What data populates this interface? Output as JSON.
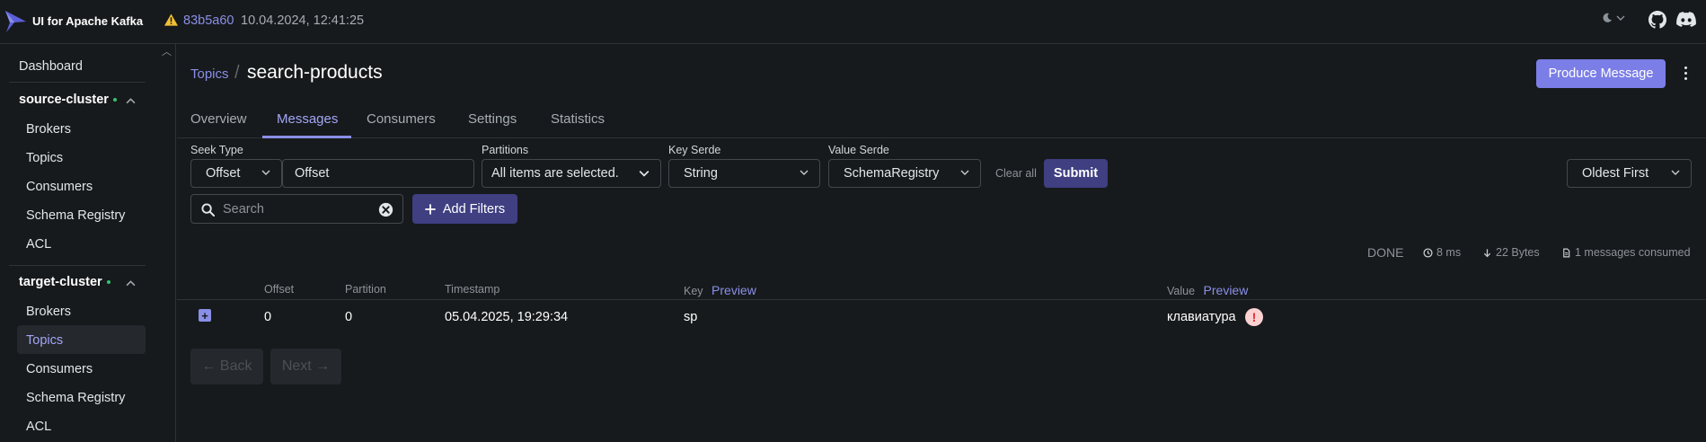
{
  "app": {
    "brand": "UI for Apache Kafka",
    "version": "83b5a60",
    "build_date": "10.04.2024, 12:41:25",
    "accent_color": "#8a8fe8",
    "icons": [
      "kafka-logo-icon",
      "warning-icon",
      "moon-icon",
      "chevron-down-icon",
      "github-icon",
      "discord-icon"
    ]
  },
  "sidebar": {
    "dashboard": "Dashboard",
    "clusters": [
      {
        "name": "source-cluster",
        "items": [
          "Brokers",
          "Topics",
          "Consumers",
          "Schema Registry",
          "ACL"
        ]
      },
      {
        "name": "target-cluster",
        "items": [
          "Brokers",
          "Topics",
          "Consumers",
          "Schema Registry",
          "ACL"
        ],
        "active_item": "Topics"
      }
    ]
  },
  "breadcrumb": {
    "parent": "Topics",
    "separator": "/",
    "current": "search-products"
  },
  "actions": {
    "produce_message": "Produce Message"
  },
  "tabs": [
    {
      "label": "Overview"
    },
    {
      "label": "Messages",
      "active": true
    },
    {
      "label": "Consumers"
    },
    {
      "label": "Settings"
    },
    {
      "label": "Statistics"
    }
  ],
  "filters": {
    "seek_type_label": "Seek Type",
    "seek_type_value": "Offset",
    "offset_placeholder": "Offset",
    "partitions_label": "Partitions",
    "partitions_value": "All items are selected.",
    "key_serde_label": "Key Serde",
    "key_serde_value": "String",
    "value_serde_label": "Value Serde",
    "value_serde_value": "SchemaRegistry",
    "clear_all": "Clear all",
    "submit": "Submit",
    "sort_value": "Oldest First",
    "search_placeholder": "Search",
    "add_filters": "Add Filters"
  },
  "status": {
    "state": "DONE",
    "elapsed": "8 ms",
    "bytes": "22 Bytes",
    "consumed": "1 messages consumed"
  },
  "table": {
    "columns": {
      "offset": "Offset",
      "partition": "Partition",
      "timestamp": "Timestamp",
      "key": "Key",
      "key_preview": "Preview",
      "value": "Value",
      "value_preview": "Preview"
    },
    "rows": [
      {
        "offset": "0",
        "partition": "0",
        "timestamp": "05.04.2025, 19:29:34",
        "key": "sp",
        "value": "клавиатура",
        "error_mark": "!"
      }
    ]
  },
  "pagination": {
    "back": "← Back",
    "next": "Next →"
  }
}
